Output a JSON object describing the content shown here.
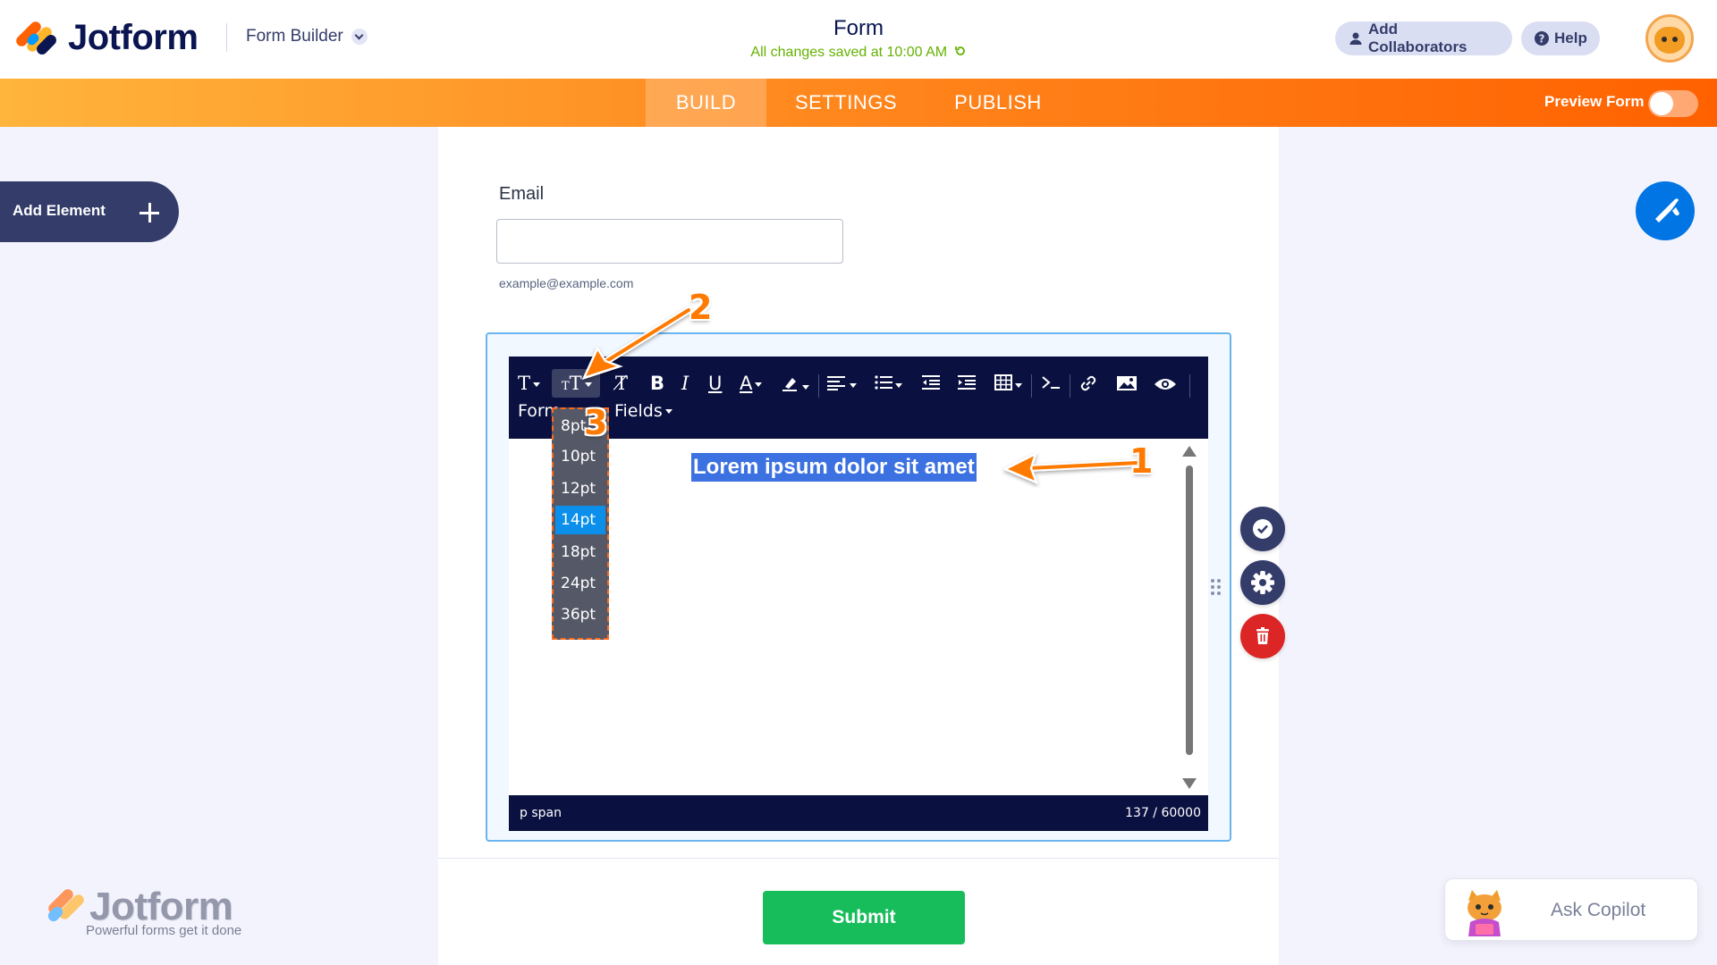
{
  "header": {
    "logo_text": "Jotform",
    "builder_menu": "Form Builder",
    "form_title": "Form",
    "save_status": "All changes saved at 10:00 AM",
    "add_collaborators": "Add Collaborators",
    "help": "Help"
  },
  "nav": {
    "tabs": [
      {
        "label": "BUILD",
        "active": true
      },
      {
        "label": "SETTINGS",
        "active": false
      },
      {
        "label": "PUBLISH",
        "active": false
      }
    ],
    "preview_label": "Preview Form",
    "preview_on": false
  },
  "sidebar": {
    "add_element": "Add Element"
  },
  "form": {
    "email_label": "Email",
    "email_value": "",
    "email_sublabel": "example@example.com",
    "submit_label": "Submit"
  },
  "editor": {
    "toolbar_row2": {
      "format_label": "Form",
      "fields_label": "Fields"
    },
    "content_text": "Lorem ipsum dolor sit amet",
    "status_path": "p  span",
    "char_count": "137 / 60000",
    "font_sizes": [
      "8pt",
      "10pt",
      "12pt",
      "14pt",
      "18pt",
      "24pt",
      "36pt"
    ],
    "selected_font_size": "14pt"
  },
  "annotations": [
    "1",
    "2",
    "3"
  ],
  "watermark": {
    "logo_text": "Jotform",
    "tagline": "Powerful forms get it done"
  },
  "copilot": {
    "label": "Ask Copilot"
  },
  "colors": {
    "accent_orange": "#ff6100",
    "navy": "#0a1551",
    "submit_green": "#18bd5b",
    "selection_blue": "#3b71e0",
    "brush_blue": "#0075e3",
    "delete_red": "#dc2626"
  }
}
